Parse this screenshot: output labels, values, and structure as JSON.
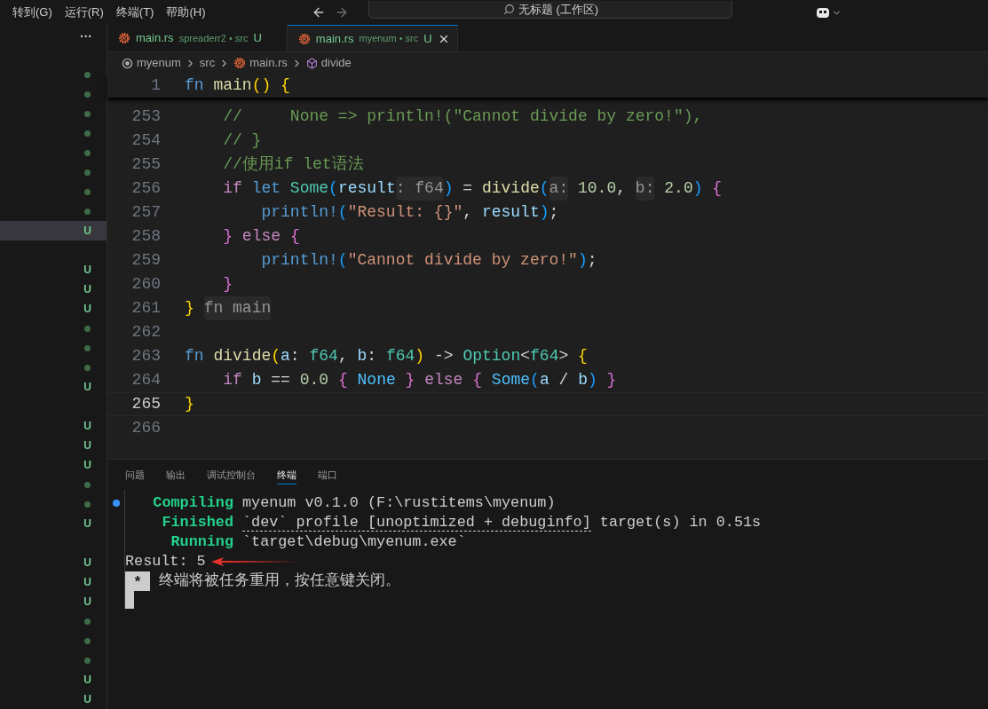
{
  "menu": [
    "转到(G)",
    "运行(R)",
    "终端(T)",
    "帮助(H)"
  ],
  "search": {
    "value": "无标题 (工作区)"
  },
  "sidebar": {
    "more": "···",
    "items": [
      {
        "kind": "dot",
        "selected": false
      },
      {
        "kind": "dot",
        "selected": false
      },
      {
        "kind": "dot",
        "selected": false
      },
      {
        "kind": "dot",
        "selected": false
      },
      {
        "kind": "dot",
        "selected": false
      },
      {
        "kind": "dot",
        "selected": false
      },
      {
        "kind": "dot",
        "selected": false
      },
      {
        "kind": "dot",
        "selected": false
      },
      {
        "kind": "status",
        "text": "U",
        "selected": true
      },
      {
        "kind": "none",
        "selected": false
      },
      {
        "kind": "status",
        "text": "U",
        "selected": false
      },
      {
        "kind": "status",
        "text": "U",
        "selected": false
      },
      {
        "kind": "status",
        "text": "U",
        "selected": false
      },
      {
        "kind": "dot",
        "selected": false
      },
      {
        "kind": "dot",
        "selected": false
      },
      {
        "kind": "dot",
        "selected": false
      },
      {
        "kind": "status",
        "text": "U",
        "selected": false
      },
      {
        "kind": "none",
        "selected": false
      },
      {
        "kind": "status",
        "text": "U",
        "selected": false
      },
      {
        "kind": "status",
        "text": "U",
        "selected": false
      },
      {
        "kind": "status",
        "text": "U",
        "selected": false
      },
      {
        "kind": "dot",
        "selected": false
      },
      {
        "kind": "dot",
        "selected": false
      },
      {
        "kind": "status",
        "text": "U",
        "selected": false
      },
      {
        "kind": "none",
        "selected": false
      },
      {
        "kind": "status",
        "text": "U",
        "selected": false
      },
      {
        "kind": "status",
        "text": "U",
        "selected": false
      },
      {
        "kind": "status",
        "text": "U",
        "selected": false
      },
      {
        "kind": "dot",
        "selected": false
      },
      {
        "kind": "dot",
        "selected": false
      },
      {
        "kind": "dot",
        "selected": false
      },
      {
        "kind": "status",
        "text": "U",
        "selected": false
      },
      {
        "kind": "status",
        "text": "U",
        "selected": false
      }
    ]
  },
  "tabs": [
    {
      "name": "main.rs",
      "detail": "spreaderr2 • src",
      "status": "U",
      "selected": false
    },
    {
      "name": "main.rs",
      "detail": "myenum • src",
      "status": "U",
      "selected": true
    }
  ],
  "breadcrumb": [
    {
      "kind": "folder",
      "text": "myenum"
    },
    {
      "kind": "folder",
      "text": "src"
    },
    {
      "kind": "file",
      "text": "main.rs"
    },
    {
      "kind": "symbol",
      "text": "divide"
    }
  ],
  "sticky": {
    "number": "1",
    "tokens": [
      {
        "kind": "kw",
        "text": "fn "
      },
      {
        "kind": "fn",
        "text": "main"
      },
      {
        "kind": "b1",
        "text": "() {"
      }
    ]
  },
  "lines": [
    {
      "number": "253",
      "active": false,
      "tokens": [
        {
          "kind": "cm",
          "text": "    //     None => println!(\"Cannot divide by zero!\"),"
        }
      ]
    },
    {
      "number": "254",
      "active": false,
      "tokens": [
        {
          "kind": "cm",
          "text": "    // }"
        }
      ]
    },
    {
      "number": "255",
      "active": false,
      "tokens": [
        {
          "kind": "cm",
          "text": "    //使用if let语法"
        }
      ]
    },
    {
      "number": "256",
      "active": false,
      "tokens": [
        {
          "kind": "ctl",
          "text": "    if "
        },
        {
          "kind": "kw",
          "text": "let "
        },
        {
          "kind": "ty",
          "text": "Some"
        },
        {
          "kind": "b3",
          "text": "("
        },
        {
          "kind": "var",
          "text": "result"
        },
        {
          "kind": "hint",
          "text": ": f64"
        },
        {
          "kind": "b3",
          "text": ")"
        },
        {
          "kind": "p",
          "text": " = "
        },
        {
          "kind": "fn",
          "text": "divide"
        },
        {
          "kind": "b3",
          "text": "("
        },
        {
          "kind": "hint",
          "text": "a:"
        },
        {
          "kind": "num",
          "text": " 10.0"
        },
        {
          "kind": "p",
          "text": ", "
        },
        {
          "kind": "hint",
          "text": "b:"
        },
        {
          "kind": "num",
          "text": " 2.0"
        },
        {
          "kind": "b3",
          "text": ") "
        },
        {
          "kind": "b2",
          "text": "{"
        }
      ]
    },
    {
      "number": "257",
      "active": false,
      "tokens": [
        {
          "kind": "mac",
          "text": "        println!"
        },
        {
          "kind": "b3",
          "text": "("
        },
        {
          "kind": "str",
          "text": "\"Result: {}\""
        },
        {
          "kind": "p",
          "text": ", "
        },
        {
          "kind": "var",
          "text": "result"
        },
        {
          "kind": "b3",
          "text": ")"
        },
        {
          "kind": "p",
          "text": ";"
        }
      ]
    },
    {
      "number": "258",
      "active": false,
      "tokens": [
        {
          "kind": "b2",
          "text": "    } "
        },
        {
          "kind": "ctl",
          "text": "else "
        },
        {
          "kind": "b2",
          "text": "{"
        }
      ]
    },
    {
      "number": "259",
      "active": false,
      "tokens": [
        {
          "kind": "mac",
          "text": "        println!"
        },
        {
          "kind": "b3",
          "text": "("
        },
        {
          "kind": "str",
          "text": "\"Cannot divide by zero!\""
        },
        {
          "kind": "b3",
          "text": ")"
        },
        {
          "kind": "p",
          "text": ";"
        }
      ]
    },
    {
      "number": "260",
      "active": false,
      "tokens": [
        {
          "kind": "b2",
          "text": "    }"
        }
      ]
    },
    {
      "number": "261",
      "active": false,
      "tokens": [
        {
          "kind": "b1",
          "text": "} "
        },
        {
          "kind": "hint",
          "text": "fn main"
        }
      ]
    },
    {
      "number": "262",
      "active": false
    },
    {
      "number": "263",
      "active": false,
      "tokens": [
        {
          "kind": "kw",
          "text": "fn "
        },
        {
          "kind": "fn",
          "text": "divide"
        },
        {
          "kind": "b1",
          "text": "("
        },
        {
          "kind": "var",
          "text": "a"
        },
        {
          "kind": "p",
          "text": ": "
        },
        {
          "kind": "ty",
          "text": "f64"
        },
        {
          "kind": "p",
          "text": ", "
        },
        {
          "kind": "var",
          "text": "b"
        },
        {
          "kind": "p",
          "text": ": "
        },
        {
          "kind": "ty",
          "text": "f64"
        },
        {
          "kind": "b1",
          "text": ")"
        },
        {
          "kind": "p",
          "text": " -> "
        },
        {
          "kind": "ty",
          "text": "Option"
        },
        {
          "kind": "p",
          "text": "<"
        },
        {
          "kind": "ty",
          "text": "f64"
        },
        {
          "kind": "p",
          "text": "> "
        },
        {
          "kind": "b1",
          "text": "{"
        }
      ]
    },
    {
      "number": "264",
      "active": false,
      "tokens": [
        {
          "kind": "ctl",
          "text": "    if "
        },
        {
          "kind": "var",
          "text": "b"
        },
        {
          "kind": "p",
          "text": " == "
        },
        {
          "kind": "num",
          "text": "0.0 "
        },
        {
          "kind": "b2",
          "text": "{ "
        },
        {
          "kind": "en",
          "text": "None "
        },
        {
          "kind": "b2",
          "text": "} "
        },
        {
          "kind": "ctl",
          "text": "else "
        },
        {
          "kind": "b2",
          "text": "{ "
        },
        {
          "kind": "en",
          "text": "Some"
        },
        {
          "kind": "b3",
          "text": "("
        },
        {
          "kind": "var",
          "text": "a"
        },
        {
          "kind": "p",
          "text": " / "
        },
        {
          "kind": "var",
          "text": "b"
        },
        {
          "kind": "b3",
          "text": ") "
        },
        {
          "kind": "b2",
          "text": "}"
        }
      ]
    },
    {
      "number": "265",
      "active": true,
      "tokens": [
        {
          "kind": "b1",
          "text": "}"
        }
      ]
    },
    {
      "number": "266",
      "active": false
    }
  ],
  "panel_tabs": [
    {
      "label": "问题",
      "selected": false
    },
    {
      "label": "输出",
      "selected": false
    },
    {
      "label": "调试控制台",
      "selected": false
    },
    {
      "label": "终端",
      "selected": true
    },
    {
      "label": "端口",
      "selected": false
    }
  ],
  "terminal": [
    {
      "kind": "cargo",
      "label": "Compiling",
      "parts": [
        {
          "kind": "text",
          "text": "myenum v0.1.0 (F:\\rustitems\\myenum)"
        }
      ]
    },
    {
      "kind": "cargo",
      "label": "Finished",
      "parts": [
        {
          "kind": "link",
          "text": "`dev` profile [unoptimized + debuginfo]"
        },
        {
          "kind": "text",
          "text": " target(s) in 0.51s"
        }
      ]
    },
    {
      "kind": "cargo",
      "label": "Running",
      "parts": [
        {
          "kind": "text",
          "text": "`target\\debug\\myenum.exe`"
        }
      ]
    },
    {
      "kind": "output",
      "text": "Result: 5"
    },
    {
      "kind": "task",
      "marker": "*",
      "text": "终端将被任务重用，按任意键关闭。"
    }
  ]
}
